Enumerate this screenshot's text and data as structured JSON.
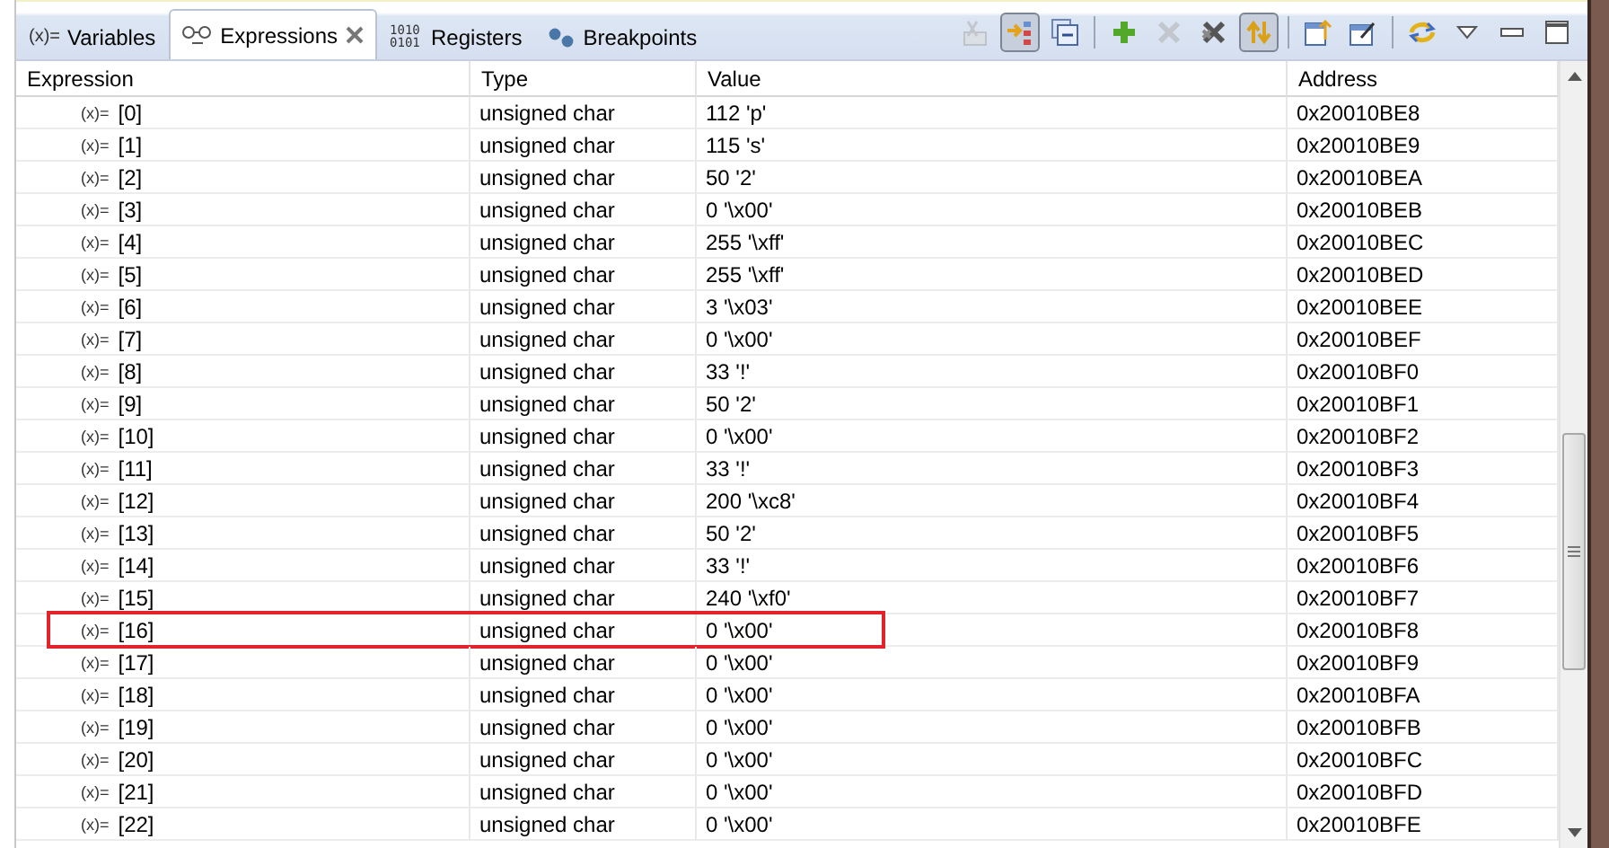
{
  "tabs": [
    {
      "label": "Variables",
      "icon_text": "(x)=",
      "selected": false
    },
    {
      "label": "Expressions",
      "selected": true
    },
    {
      "label": "Registers",
      "icon_text": "1010 0101",
      "selected": false
    },
    {
      "label": "Breakpoints",
      "selected": false
    }
  ],
  "toolbar": [
    {
      "kind": "new-expression",
      "pressed": false,
      "disabled": true
    },
    {
      "kind": "show-type",
      "pressed": true,
      "disabled": false
    },
    {
      "kind": "collapse",
      "pressed": false
    },
    {
      "kind": "sep"
    },
    {
      "kind": "add",
      "pressed": false
    },
    {
      "kind": "remove",
      "pressed": false,
      "disabled": true
    },
    {
      "kind": "remove-all",
      "pressed": false
    },
    {
      "kind": "sync",
      "pressed": true
    },
    {
      "kind": "sep"
    },
    {
      "kind": "export",
      "pressed": false
    },
    {
      "kind": "edit",
      "pressed": false
    },
    {
      "kind": "sep"
    },
    {
      "kind": "refresh",
      "pressed": false
    },
    {
      "kind": "menu",
      "pressed": false
    },
    {
      "kind": "minimize",
      "pressed": false
    },
    {
      "kind": "maximize",
      "pressed": false
    }
  ],
  "table": {
    "columns": [
      "Expression",
      "Type",
      "Value",
      "Address"
    ],
    "rows": [
      {
        "icon_text": "(x)=",
        "expression": "[0]",
        "type": "unsigned char",
        "value": "112 'p'",
        "address": "0x20010BE8",
        "highlighted": false
      },
      {
        "icon_text": "(x)=",
        "expression": "[1]",
        "type": "unsigned char",
        "value": "115 's'",
        "address": "0x20010BE9",
        "highlighted": false
      },
      {
        "icon_text": "(x)=",
        "expression": "[2]",
        "type": "unsigned char",
        "value": "50 '2'",
        "address": "0x20010BEA",
        "highlighted": false
      },
      {
        "icon_text": "(x)=",
        "expression": "[3]",
        "type": "unsigned char",
        "value": "0 '\\x00'",
        "address": "0x20010BEB",
        "highlighted": false
      },
      {
        "icon_text": "(x)=",
        "expression": "[4]",
        "type": "unsigned char",
        "value": "255 '\\xff'",
        "address": "0x20010BEC",
        "highlighted": false
      },
      {
        "icon_text": "(x)=",
        "expression": "[5]",
        "type": "unsigned char",
        "value": "255 '\\xff'",
        "address": "0x20010BED",
        "highlighted": false
      },
      {
        "icon_text": "(x)=",
        "expression": "[6]",
        "type": "unsigned char",
        "value": "3 '\\x03'",
        "address": "0x20010BEE",
        "highlighted": false
      },
      {
        "icon_text": "(x)=",
        "expression": "[7]",
        "type": "unsigned char",
        "value": "0 '\\x00'",
        "address": "0x20010BEF",
        "highlighted": false
      },
      {
        "icon_text": "(x)=",
        "expression": "[8]",
        "type": "unsigned char",
        "value": "33 '!'",
        "address": "0x20010BF0",
        "highlighted": false
      },
      {
        "icon_text": "(x)=",
        "expression": "[9]",
        "type": "unsigned char",
        "value": "50 '2'",
        "address": "0x20010BF1",
        "highlighted": false
      },
      {
        "icon_text": "(x)=",
        "expression": "[10]",
        "type": "unsigned char",
        "value": "0 '\\x00'",
        "address": "0x20010BF2",
        "highlighted": false
      },
      {
        "icon_text": "(x)=",
        "expression": "[11]",
        "type": "unsigned char",
        "value": "33 '!'",
        "address": "0x20010BF3",
        "highlighted": false
      },
      {
        "icon_text": "(x)=",
        "expression": "[12]",
        "type": "unsigned char",
        "value": "200 '\\xc8'",
        "address": "0x20010BF4",
        "highlighted": false
      },
      {
        "icon_text": "(x)=",
        "expression": "[13]",
        "type": "unsigned char",
        "value": "50 '2'",
        "address": "0x20010BF5",
        "highlighted": false
      },
      {
        "icon_text": "(x)=",
        "expression": "[14]",
        "type": "unsigned char",
        "value": "33 '!'",
        "address": "0x20010BF6",
        "highlighted": false
      },
      {
        "icon_text": "(x)=",
        "expression": "[15]",
        "type": "unsigned char",
        "value": "240 '\\xf0'",
        "address": "0x20010BF7",
        "highlighted": false
      },
      {
        "icon_text": "(x)=",
        "expression": "[16]",
        "type": "unsigned char",
        "value": "0 '\\x00'",
        "address": "0x20010BF8",
        "highlighted": true
      },
      {
        "icon_text": "(x)=",
        "expression": "[17]",
        "type": "unsigned char",
        "value": "0 '\\x00'",
        "address": "0x20010BF9",
        "highlighted": false
      },
      {
        "icon_text": "(x)=",
        "expression": "[18]",
        "type": "unsigned char",
        "value": "0 '\\x00'",
        "address": "0x20010BFA",
        "highlighted": false
      },
      {
        "icon_text": "(x)=",
        "expression": "[19]",
        "type": "unsigned char",
        "value": "0 '\\x00'",
        "address": "0x20010BFB",
        "highlighted": false
      },
      {
        "icon_text": "(x)=",
        "expression": "[20]",
        "type": "unsigned char",
        "value": "0 '\\x00'",
        "address": "0x20010BFC",
        "highlighted": false
      },
      {
        "icon_text": "(x)=",
        "expression": "[21]",
        "type": "unsigned char",
        "value": "0 '\\x00'",
        "address": "0x20010BFD",
        "highlighted": false
      },
      {
        "icon_text": "(x)=",
        "expression": "[22]",
        "type": "unsigned char",
        "value": "0 '\\x00'",
        "address": "0x20010BFE",
        "highlighted": false
      }
    ]
  }
}
